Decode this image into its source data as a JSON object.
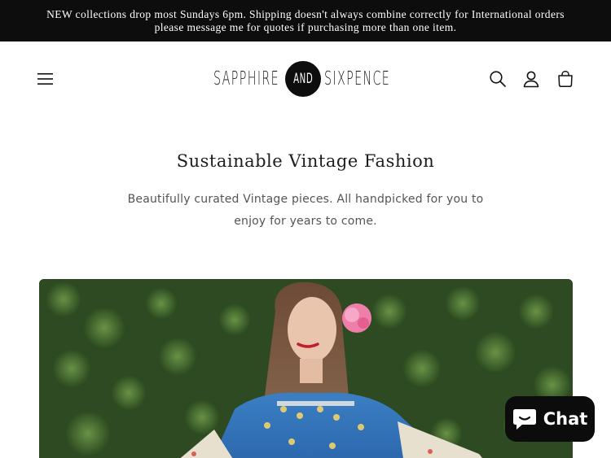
{
  "announcement": {
    "text": "NEW collections drop most Sundays 6pm. Shipping doesn't always combine correctly for International orders please message me for quotes if purchasing more than one item."
  },
  "header": {
    "menu_icon": "hamburger-menu-icon",
    "logo": {
      "left": "SAPPHIRE",
      "center": "AND",
      "right": "SIXPENCE"
    },
    "icons": [
      "search-icon",
      "account-icon",
      "cart-icon"
    ]
  },
  "intro": {
    "title": "Sustainable Vintage Fashion",
    "description": "Beautifully curated Vintage pieces. All handpicked for you to enjoy for years to come."
  },
  "hero": {
    "image": "hero-photo",
    "subject": "woman in embroidered vintage kaftan with pink flower in hair against green hedge"
  },
  "chat": {
    "label": "Chat",
    "icon": "chat-bubble-icon"
  },
  "colors": {
    "announcement_bg": "#0d0d0d",
    "text": "#121212",
    "muted_text": "#555555",
    "chat_bg": "#0c0c0c"
  }
}
